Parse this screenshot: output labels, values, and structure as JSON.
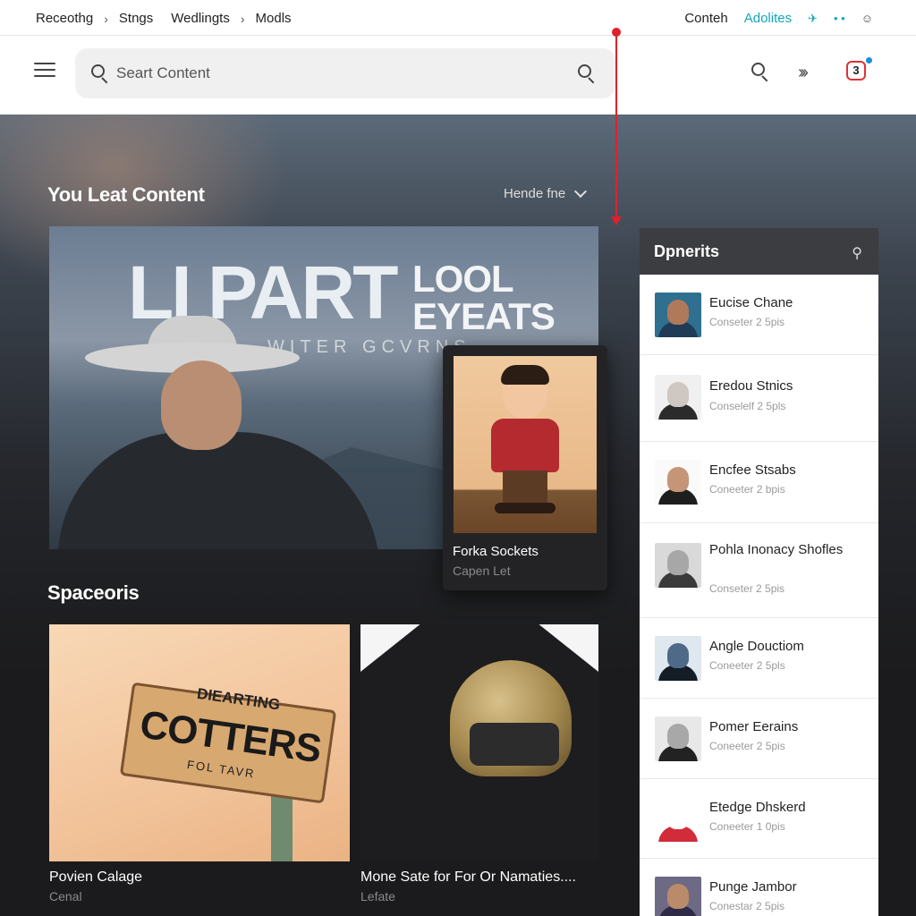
{
  "breadcrumbs": [
    "Receothg",
    "Stngs",
    "Wedlingts",
    "Modls"
  ],
  "top_links": {
    "content": "Conteh",
    "updates": "Adolites"
  },
  "search": {
    "placeholder": "Seart Content"
  },
  "section_main": {
    "title": "You Leat Content",
    "sort_label": "Hende fne"
  },
  "featured": {
    "headline": "LI PART",
    "headline2_line1": "LOOL",
    "headline2_line2": "EYEATS",
    "subline": "WITER GCVRNS"
  },
  "overlay_card": {
    "title": "Forka Sockets",
    "subtitle": "Capen Let"
  },
  "section_secondary": {
    "title": "Spaceoris"
  },
  "tiles": [
    {
      "title": "Povien Calage",
      "subtitle": "Cenal",
      "sign_top": "DIEARTING",
      "sign_main": "COTTERS",
      "sign_bottom": "FOL TAVR"
    },
    {
      "title": "Mone Sate for For Or Namaties....",
      "subtitle": "Lefate"
    }
  ],
  "panel": {
    "title": "Dpnerits",
    "items": [
      {
        "name": "Eucise Chane",
        "meta": "Conseter 2 5pis",
        "skin": "#b07a5a",
        "bg": "#2f6f8f",
        "cloth": "#1f3b55"
      },
      {
        "name": "Eredou Stnics",
        "meta": "Conselelf 2 5pls",
        "skin": "#cfc7c2",
        "bg": "#f0f0f0",
        "cloth": "#2b2b2b"
      },
      {
        "name": "Encfee Stsabs",
        "meta": "Coneeter 2 bpis",
        "skin": "#c69476",
        "bg": "#fafafa",
        "cloth": "#1e1e1e"
      },
      {
        "name": "Pohla Inonacy Shofles",
        "meta": "Conseter 2 5pis",
        "skin": "#a7a7a7",
        "bg": "#d9d9d9",
        "cloth": "#3a3a3a"
      },
      {
        "name": "Angle Douctiom",
        "meta": "Coneeter 2 5pls",
        "skin": "#4e6a88",
        "bg": "#dfe7ef",
        "cloth": "#141c26"
      },
      {
        "name": "Pomer Eerains",
        "meta": "Coneeter 2 5pis",
        "skin": "#a8a8a8",
        "bg": "#e8e8e8",
        "cloth": "#222222"
      },
      {
        "name": "Etedge Dhskerd",
        "meta": "Coneeter 1 0pis",
        "skin": "#ffffff",
        "bg": "#ffffff",
        "cloth": "#d22b3a"
      },
      {
        "name": "Punge Jambor",
        "meta": "Conestar 2 5pis",
        "skin": "#b98b6a",
        "bg": "#6d6a86",
        "cloth": "#2f2a45"
      }
    ]
  },
  "colors": {
    "accent": "#13a6b8",
    "marker": "#e0212b",
    "panel_header": "#3c3d41"
  }
}
